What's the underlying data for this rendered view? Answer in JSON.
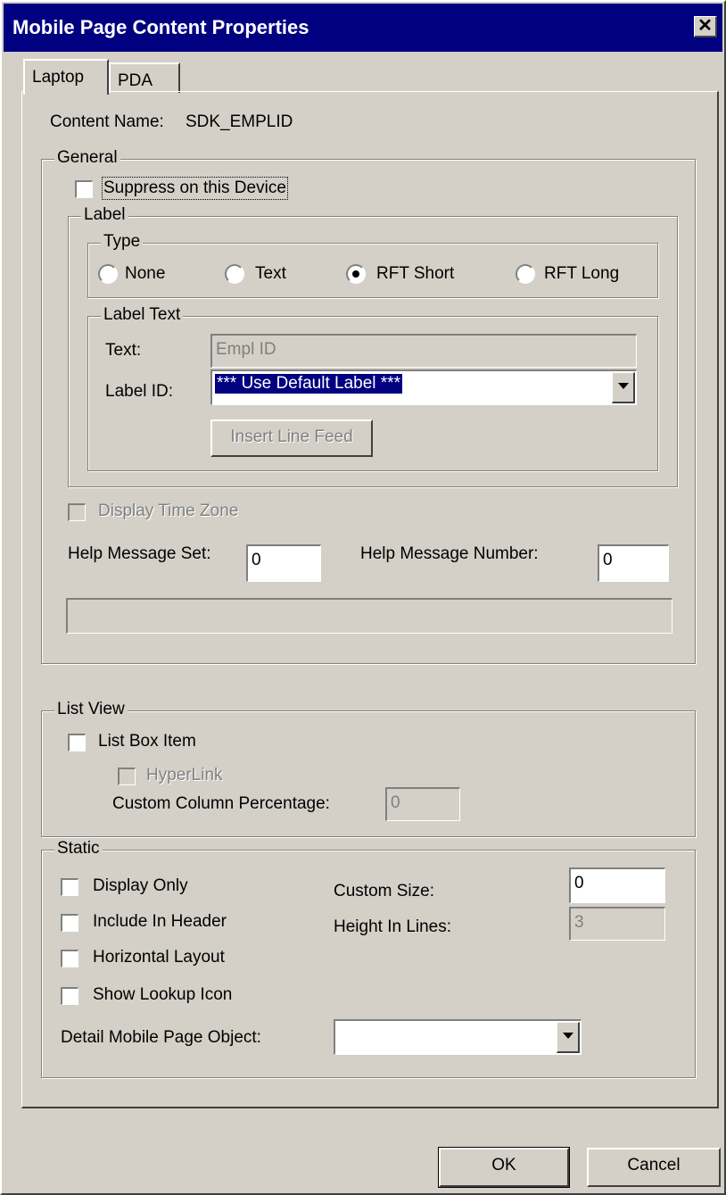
{
  "window": {
    "title": "Mobile Page Content Properties",
    "close_glyph": "✕"
  },
  "tabs": [
    {
      "label": "Laptop",
      "active": true
    },
    {
      "label": "PDA",
      "active": false
    }
  ],
  "content_name": {
    "label": "Content Name:",
    "value": "SDK_EMPLID"
  },
  "general": {
    "legend": "General",
    "suppress_label": "Suppress on this Device",
    "label_group": {
      "legend": "Label",
      "type": {
        "legend": "Type",
        "options": [
          {
            "label": "None",
            "selected": false
          },
          {
            "label": "Text",
            "selected": false
          },
          {
            "label": "RFT Short",
            "selected": true
          },
          {
            "label": "RFT Long",
            "selected": false
          }
        ]
      },
      "label_text": {
        "legend": "Label Text",
        "text_label": "Text:",
        "text_value": "Empl ID",
        "label_id_label": "Label ID:",
        "label_id_value": "*** Use Default Label ***",
        "insert_line_feed": "Insert Line Feed"
      }
    },
    "display_time_zone": "Display Time Zone",
    "help_message_set_label": "Help Message Set:",
    "help_message_set_value": "0",
    "help_message_number_label": "Help Message Number:",
    "help_message_number_value": "0"
  },
  "list_view": {
    "legend": "List View",
    "list_box_item": "List Box Item",
    "hyperlink": "HyperLink",
    "custom_column_label": "Custom Column Percentage:",
    "custom_column_value": "0"
  },
  "static": {
    "legend": "Static",
    "display_only": "Display Only",
    "include_in_header": "Include In Header",
    "horizontal_layout": "Horizontal Layout",
    "show_lookup_icon": "Show Lookup Icon",
    "custom_size_label": "Custom Size:",
    "custom_size_value": "0",
    "height_in_lines_label": "Height In Lines:",
    "height_in_lines_value": "3",
    "detail_object_label": "Detail Mobile Page Object:",
    "detail_object_value": ""
  },
  "buttons": {
    "ok": "OK",
    "cancel": "Cancel"
  },
  "colors": {
    "face": "#d4d0c8",
    "title_bar": "#000080",
    "highlight": "#ffffff",
    "shadow": "#808080"
  }
}
